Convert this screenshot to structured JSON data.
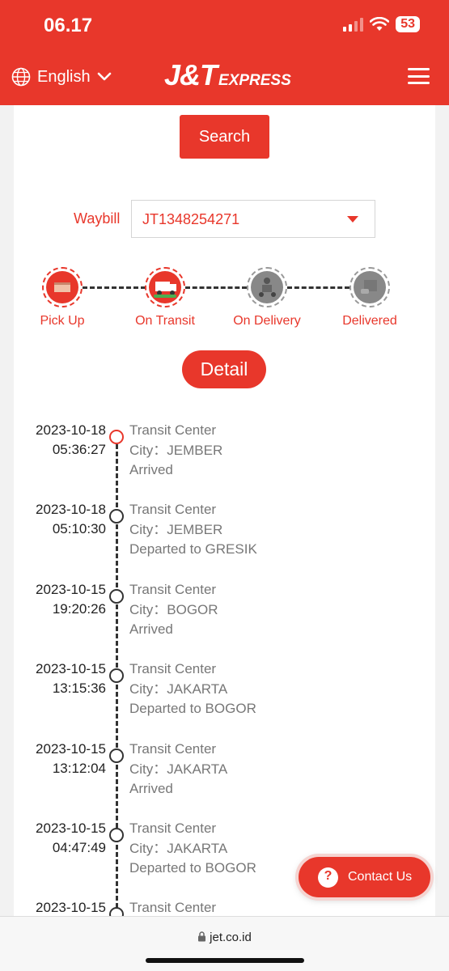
{
  "status_bar": {
    "time": "06.17",
    "battery": "53"
  },
  "header": {
    "language": "English",
    "logo_main": "J&T",
    "logo_sub": "EXPRESS"
  },
  "search": {
    "button_label": "Search"
  },
  "waybill": {
    "label": "Waybill",
    "value": "JT1348254271"
  },
  "steps": [
    {
      "label": "Pick Up",
      "active": true
    },
    {
      "label": "On Transit",
      "active": true
    },
    {
      "label": "On Delivery",
      "active": false
    },
    {
      "label": "Delivered",
      "active": false
    }
  ],
  "detail_button": "Detail",
  "timeline": [
    {
      "date": "2023-10-18",
      "time": "05:36:27",
      "title": "Transit Center",
      "city": "City：JEMBER",
      "status": "Arrived"
    },
    {
      "date": "2023-10-18",
      "time": "05:10:30",
      "title": "Transit Center",
      "city": "City：JEMBER",
      "status": "Departed to GRESIK"
    },
    {
      "date": "2023-10-15",
      "time": "19:20:26",
      "title": "Transit Center",
      "city": "City：BOGOR",
      "status": "Arrived"
    },
    {
      "date": "2023-10-15",
      "time": "13:15:36",
      "title": "Transit Center",
      "city": "City：JAKARTA",
      "status": "Departed to BOGOR"
    },
    {
      "date": "2023-10-15",
      "time": "13:12:04",
      "title": "Transit Center",
      "city": "City：JAKARTA",
      "status": "Arrived"
    },
    {
      "date": "2023-10-15",
      "time": "04:47:49",
      "title": "Transit Center",
      "city": "City：JAKARTA",
      "status": "Departed to BOGOR"
    },
    {
      "date": "2023-10-15",
      "time": "",
      "title": "Transit Center",
      "city": "",
      "status": ""
    }
  ],
  "contact": {
    "label": "Contact Us",
    "icon": "?"
  },
  "browser": {
    "url": "jet.co.id"
  },
  "colors": {
    "brand": "#e8372b",
    "text_grey": "#777777"
  }
}
